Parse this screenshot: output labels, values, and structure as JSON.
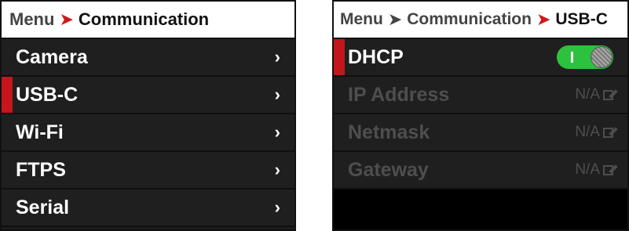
{
  "left": {
    "breadcrumb": {
      "root": "Menu",
      "current": "Communication"
    },
    "items": [
      {
        "label": "Camera",
        "selected": false
      },
      {
        "label": "USB-C",
        "selected": true
      },
      {
        "label": "Wi-Fi",
        "selected": false
      },
      {
        "label": "FTPS",
        "selected": false
      },
      {
        "label": "Serial",
        "selected": false
      }
    ]
  },
  "right": {
    "breadcrumb": {
      "root": "Menu",
      "middle": "Communication",
      "current": "USB-C"
    },
    "dhcp": {
      "label": "DHCP",
      "enabled": true
    },
    "fields": [
      {
        "label": "IP Address",
        "value": "N/A"
      },
      {
        "label": "Netmask",
        "value": "N/A"
      },
      {
        "label": "Gateway",
        "value": "N/A"
      }
    ]
  },
  "colors": {
    "accent_red": "#c4161c",
    "toggle_green": "#2cc23e",
    "panel_bg": "#1f1f1f"
  },
  "icons": {
    "arrow": "chevron-right-icon",
    "edit": "edit-icon"
  }
}
